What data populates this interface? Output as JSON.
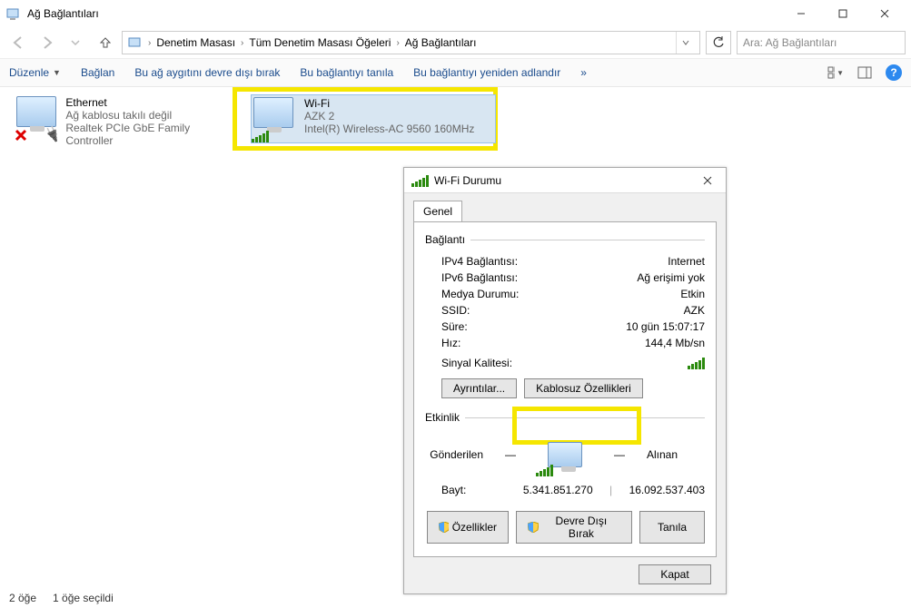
{
  "window": {
    "title": "Ağ Bağlantıları"
  },
  "breadcrumb": {
    "root_icon": "network-folder",
    "items": [
      "Denetim Masası",
      "Tüm Denetim Masası Öğeleri",
      "Ağ Bağlantıları"
    ]
  },
  "search": {
    "placeholder": "Ara: Ağ Bağlantıları"
  },
  "toolbar": {
    "organize": "Düzenle",
    "connect": "Bağlan",
    "disable": "Bu ağ aygıtını devre dışı bırak",
    "diagnose": "Bu bağlantıyı tanıla",
    "rename": "Bu bağlantıyı yeniden adlandır",
    "more": "»"
  },
  "connections": [
    {
      "name": "Ethernet",
      "status": "Ağ kablosu takılı değil",
      "adapter": "Realtek PCIe GbE Family Controller",
      "kind": "ethernet-unplugged"
    },
    {
      "name": "Wi-Fi",
      "status": "AZK 2",
      "adapter": "Intel(R) Wireless-AC 9560 160MHz",
      "kind": "wifi"
    }
  ],
  "dialog": {
    "title": "Wi-Fi Durumu",
    "tab_general": "Genel",
    "group_connection": "Bağlantı",
    "rows": {
      "ipv4_k": "IPv4 Bağlantısı:",
      "ipv4_v": "Internet",
      "ipv6_k": "IPv6 Bağlantısı:",
      "ipv6_v": "Ağ erişimi yok",
      "media_k": "Medya Durumu:",
      "media_v": "Etkin",
      "ssid_k": "SSID:",
      "ssid_v": "AZK",
      "dur_k": "Süre:",
      "dur_v": "10 gün 15:07:17",
      "speed_k": "Hız:",
      "speed_v": "144,4 Mb/sn",
      "sigq_k": "Sinyal Kalitesi:"
    },
    "btn_details": "Ayrıntılar...",
    "btn_wireless_props": "Kablosuz Özellikleri",
    "group_activity": "Etkinlik",
    "activity": {
      "sent_label": "Gönderilen",
      "recv_label": "Alınan",
      "bytes_label": "Bayt:",
      "sent_bytes": "5.341.851.270",
      "recv_bytes": "16.092.537.403"
    },
    "btn_properties": "Özellikler",
    "btn_disable2": "Devre Dışı Bırak",
    "btn_diagnose2": "Tanıla",
    "btn_close": "Kapat"
  },
  "statusbar": {
    "count": "2 öğe",
    "selected": "1 öğe seçildi"
  }
}
